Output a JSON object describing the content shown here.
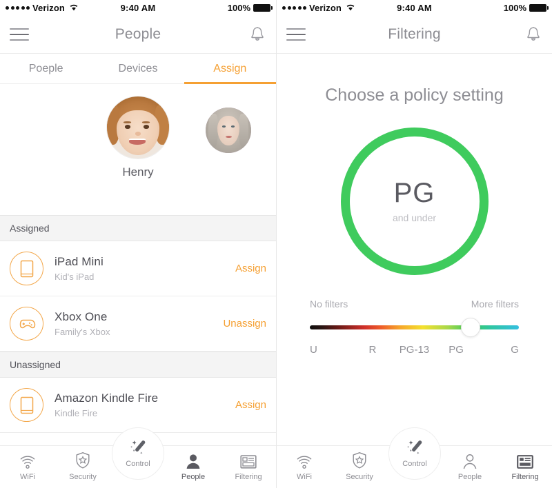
{
  "status_bar": {
    "signal_dots": 5,
    "carrier": "Verizon",
    "wifi_icon": "wifi-icon",
    "time": "9:40 AM",
    "battery_percent": "100%",
    "battery_icon": "battery-full-icon"
  },
  "left_screen": {
    "nav": {
      "menu_icon": "hamburger-menu-icon",
      "title": "People",
      "bell_icon": "bell-icon"
    },
    "tabs": [
      {
        "label": "Poeple",
        "active": false
      },
      {
        "label": "Devices",
        "active": false
      },
      {
        "label": "Assign",
        "active": true
      }
    ],
    "people": [
      {
        "name": "Henry",
        "selected": true,
        "avatar_icon": "avatar-boy"
      },
      {
        "name": "",
        "selected": false,
        "avatar_icon": "avatar-woman"
      }
    ],
    "sections": [
      {
        "header": "Assigned",
        "devices": [
          {
            "name": "iPad Mini",
            "sub": "Kid's iPad",
            "action": "Assign",
            "icon": "tablet-icon"
          },
          {
            "name": "Xbox One",
            "sub": "Family's Xbox",
            "action": "Unassign",
            "icon": "gamepad-icon"
          }
        ]
      },
      {
        "header": "Unassigned",
        "devices": [
          {
            "name": "Amazon Kindle Fire",
            "sub": "Kindle Fire",
            "action": "Assign",
            "icon": "tablet-icon"
          }
        ]
      }
    ],
    "tabbar": [
      {
        "label": "WiFi",
        "icon": "wifi-icon",
        "active": false
      },
      {
        "label": "Security",
        "icon": "shield-star-icon",
        "active": false
      },
      {
        "label": "Control",
        "icon": "magic-wand-icon",
        "active": false,
        "raised": true
      },
      {
        "label": "People",
        "icon": "person-icon",
        "active": true
      },
      {
        "label": "Filtering",
        "icon": "filter-card-icon",
        "active": false
      }
    ]
  },
  "right_screen": {
    "nav": {
      "menu_icon": "hamburger-menu-icon",
      "title": "Filtering",
      "bell_icon": "bell-icon"
    },
    "heading": "Choose a policy setting",
    "policy": {
      "rating": "PG",
      "qualifier": "and under",
      "ring_color": "#3fcb5d"
    },
    "slider": {
      "left_caption": "No filters",
      "right_caption": "More filters",
      "ticks": [
        "U",
        "R",
        "PG-13",
        "PG",
        "G"
      ],
      "selected_tick": "PG",
      "thumb_percent": 77,
      "accent_color": "#3fcb5d"
    },
    "tabbar": [
      {
        "label": "WiFi",
        "icon": "wifi-icon",
        "active": false
      },
      {
        "label": "Security",
        "icon": "shield-star-icon",
        "active": false
      },
      {
        "label": "Control",
        "icon": "magic-wand-icon",
        "active": false,
        "raised": true
      },
      {
        "label": "People",
        "icon": "person-icon",
        "active": false
      },
      {
        "label": "Filtering",
        "icon": "filter-card-icon",
        "active": true
      }
    ]
  }
}
